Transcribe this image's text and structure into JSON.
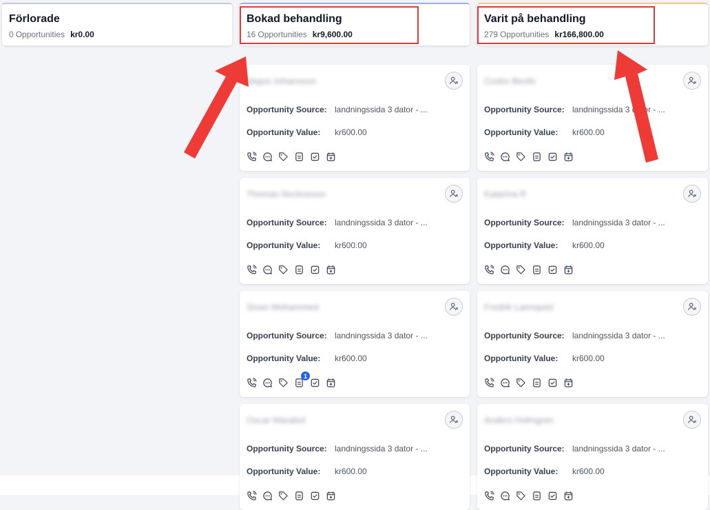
{
  "columns": [
    {
      "title": "Förlorade",
      "count": "0",
      "count_label": "Opportunities",
      "amount": "kr0.00",
      "cards": []
    },
    {
      "title": "Bokad behandling",
      "count": "16",
      "count_label": "Opportunities",
      "amount": "kr9,600.00",
      "cards": [
        {
          "name": "Majsa Johansson",
          "source_label": "Opportunity Source:",
          "source": "landningssida 3 dator - ...",
          "value_label": "Opportunity Value:",
          "value": "kr600.00"
        },
        {
          "name": "Thomas Nockosson",
          "source_label": "Opportunity Source:",
          "source": "landningssida 3 dator - ...",
          "value_label": "Opportunity Value:",
          "value": "kr600.00"
        },
        {
          "name": "Sivan Mohammed",
          "source_label": "Opportunity Source:",
          "source": "landningssida 3 dator - ...",
          "value_label": "Opportunity Value:",
          "value": "kr600.00",
          "note_badge": "1"
        },
        {
          "name": "Oscar Marabol",
          "source_label": "Opportunity Source:",
          "source": "landningssida 3 dator - ...",
          "value_label": "Opportunity Value:",
          "value": "kr600.00"
        }
      ]
    },
    {
      "title": "Varit på behandling",
      "count": "279",
      "count_label": "Opportunities",
      "amount": "kr166,800.00",
      "cards": [
        {
          "name": "Cosko Beolic",
          "source_label": "Opportunity Source:",
          "source": "landningssida 3 dator - ...",
          "value_label": "Opportunity Value:",
          "value": "kr600.00"
        },
        {
          "name": "Katarina R",
          "source_label": "Opportunity Source:",
          "source": "landningssida 3 dator - ...",
          "value_label": "Opportunity Value:",
          "value": "kr600.00"
        },
        {
          "name": "Fredrik Lannquist",
          "source_label": "Opportunity Source:",
          "source": "landningssida 3 dator - ...",
          "value_label": "Opportunity Value:",
          "value": "kr600.00"
        },
        {
          "name": "Anders Holmgren",
          "source_label": "Opportunity Source:",
          "source": "landningssida 3 dator - ...",
          "value_label": "Opportunity Value:",
          "value": "kr600.00"
        }
      ]
    }
  ],
  "card_actions": [
    "phone-icon",
    "sms-icon",
    "tag-icon",
    "note-icon",
    "task-icon",
    "appointment-icon"
  ],
  "colors": {
    "highlight": "#e53935",
    "arrow": "#ef3b36",
    "badge": "#2563eb"
  }
}
